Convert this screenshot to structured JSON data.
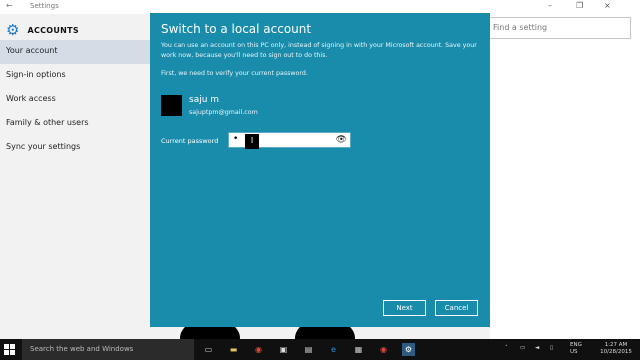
{
  "window": {
    "title": "Settings",
    "back_glyph": "←",
    "controls": [
      "–",
      "❐",
      "×"
    ]
  },
  "sidebar": {
    "header": "ACCOUNTS",
    "items": [
      {
        "label": "Your account",
        "active": true
      },
      {
        "label": "Sign-in options"
      },
      {
        "label": "Work access"
      },
      {
        "label": "Family & other users"
      },
      {
        "label": "Sync your settings"
      }
    ]
  },
  "search": {
    "placeholder": "Find a setting"
  },
  "dialog": {
    "title": "Switch to a local account",
    "description": "You can use an account on this PC only, instead of signing in with your Microsoft account. Save your work now, because you'll need to sign out to do this.",
    "verify_text": "First, we need to verify your current password.",
    "user_name": "saju m",
    "user_email": "sajuptpm@gmail.com",
    "password_label": "Current password",
    "password_value": "•",
    "next_label": "Next",
    "cancel_label": "Cancel"
  },
  "taskbar": {
    "search_placeholder": "Search the web and Windows",
    "icons": [
      "task-view-icon",
      "file-explorer-icon",
      "chrome-icon",
      "store-icon",
      "media-icon",
      "edge-icon",
      "photos-icon",
      "chrome-icon-2",
      "settings-icon"
    ],
    "tray": {
      "language": "ENG",
      "region": "US",
      "time": "1:27 AM",
      "date": "10/28/2015"
    }
  },
  "colors": {
    "dialog_bg": "#1a8cab",
    "accent": "#1979ca",
    "active_item": "#d4dce6",
    "taskbar": "#101010"
  }
}
